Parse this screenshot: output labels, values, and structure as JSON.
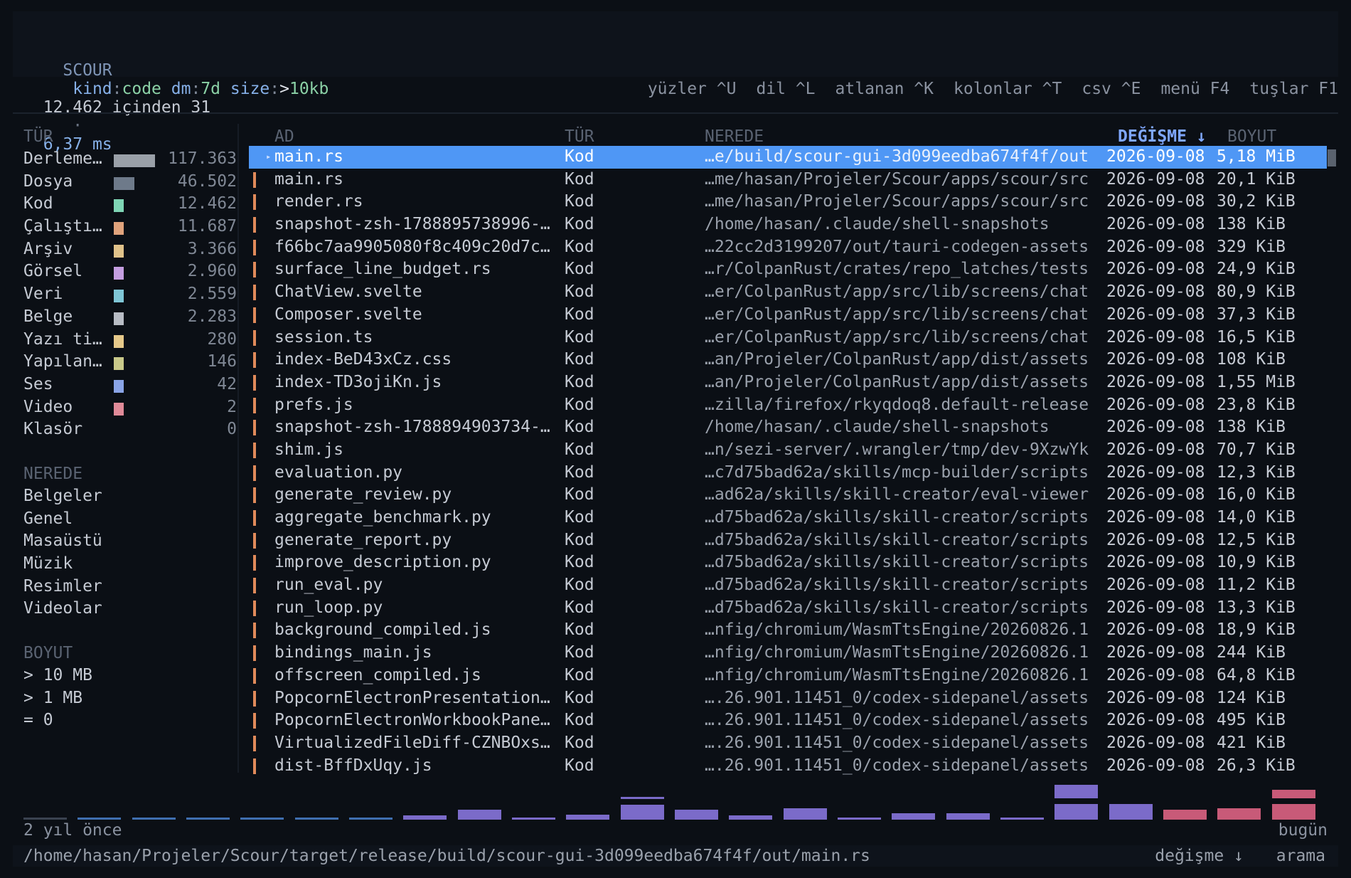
{
  "query": {
    "app": "SCOUR",
    "filters": [
      {
        "key": "kind",
        "value": "code"
      },
      {
        "key": "dm",
        "value": "7d"
      },
      {
        "key": "size",
        "value": ">10kb"
      }
    ]
  },
  "info": {
    "count": "12.462 içinden 31",
    "separator": "·",
    "time": "6,37 ms",
    "shortcuts": [
      "yüzler ^U",
      "dil ^L",
      "atlanan ^K",
      "kolonlar ^T",
      "csv ^E",
      "menü F4",
      "tuşlar F1"
    ]
  },
  "sidebar": {
    "type_header": "TÜR",
    "types": [
      {
        "label": "Derleme…",
        "count": "117.363",
        "color": "#9aa0a8",
        "fill": 1.0
      },
      {
        "label": "Dosya",
        "count": "46.502",
        "color": "#6e7a8a",
        "fill": 0.5
      },
      {
        "label": "Kod",
        "count": "12.462",
        "color": "#7fd6b5",
        "fill": 0.25
      },
      {
        "label": "Çalıştı…",
        "count": "11.687",
        "color": "#e0a37c",
        "fill": 0.25
      },
      {
        "label": "Arşiv",
        "count": "3.366",
        "color": "#e0c28a",
        "fill": 0.25
      },
      {
        "label": "Görsel",
        "count": "2.960",
        "color": "#c49ee0",
        "fill": 0.25
      },
      {
        "label": "Veri",
        "count": "2.559",
        "color": "#7fc6d6",
        "fill": 0.25
      },
      {
        "label": "Belge",
        "count": "2.283",
        "color": "#b8bcc4",
        "fill": 0.25
      },
      {
        "label": "Yazı ti…",
        "count": "280",
        "color": "#e6c98a",
        "fill": 0.25
      },
      {
        "label": "Yapılan…",
        "count": "146",
        "color": "#c9c98a",
        "fill": 0.25
      },
      {
        "label": "Ses",
        "count": "42",
        "color": "#8aa4e6",
        "fill": 0.25
      },
      {
        "label": "Video",
        "count": "2",
        "color": "#e08a98",
        "fill": 0.25
      },
      {
        "label": "Klasör",
        "count": "0",
        "color": "#000000",
        "fill": 0
      }
    ],
    "where_header": "NEREDE",
    "where": [
      "Belgeler",
      "Genel",
      "Masaüstü",
      "Müzik",
      "Resimler",
      "Videolar"
    ],
    "size_header": "BOYUT",
    "sizes": [
      "> 10 MB",
      "> 1 MB",
      "= 0"
    ]
  },
  "table": {
    "headers": {
      "name": "AD",
      "type": "TÜR",
      "where": "NEREDE",
      "modified": "DEĞİŞME ↓",
      "size": "BOYUT"
    },
    "rows": [
      {
        "name": "main.rs",
        "type": "Kod",
        "path": "…e/build/scour-gui-3d099eedba674f4f/out",
        "date": "2026-09-08",
        "size": "5,18 MiB",
        "selected": true
      },
      {
        "name": "main.rs",
        "type": "Kod",
        "path": "…me/hasan/Projeler/Scour/apps/scour/src",
        "date": "2026-09-08",
        "size": "20,1 KiB"
      },
      {
        "name": "render.rs",
        "type": "Kod",
        "path": "…me/hasan/Projeler/Scour/apps/scour/src",
        "date": "2026-09-08",
        "size": "30,2 KiB"
      },
      {
        "name": "snapshot-zsh-1788895738996-…",
        "type": "Kod",
        "path": "/home/hasan/.claude/shell-snapshots",
        "date": "2026-09-08",
        "size": "138 KiB"
      },
      {
        "name": "f66bc7aa9905080f8c409c20d7c…",
        "type": "Kod",
        "path": "…22cc2d3199207/out/tauri-codegen-assets",
        "date": "2026-09-08",
        "size": "329 KiB"
      },
      {
        "name": "surface_line_budget.rs",
        "type": "Kod",
        "path": "…r/ColpanRust/crates/repo_latches/tests",
        "date": "2026-09-08",
        "size": "24,9 KiB"
      },
      {
        "name": "ChatView.svelte",
        "type": "Kod",
        "path": "…er/ColpanRust/app/src/lib/screens/chat",
        "date": "2026-09-08",
        "size": "80,9 KiB"
      },
      {
        "name": "Composer.svelte",
        "type": "Kod",
        "path": "…er/ColpanRust/app/src/lib/screens/chat",
        "date": "2026-09-08",
        "size": "37,3 KiB"
      },
      {
        "name": "session.ts",
        "type": "Kod",
        "path": "…er/ColpanRust/app/src/lib/screens/chat",
        "date": "2026-09-08",
        "size": "16,5 KiB"
      },
      {
        "name": "index-BeD43xCz.css",
        "type": "Kod",
        "path": "…an/Projeler/ColpanRust/app/dist/assets",
        "date": "2026-09-08",
        "size": "108 KiB"
      },
      {
        "name": "index-TD3ojiKn.js",
        "type": "Kod",
        "path": "…an/Projeler/ColpanRust/app/dist/assets",
        "date": "2026-09-08",
        "size": "1,55 MiB"
      },
      {
        "name": "prefs.js",
        "type": "Kod",
        "path": "…zilla/firefox/rkyqdoq8.default-release",
        "date": "2026-09-08",
        "size": "23,8 KiB"
      },
      {
        "name": "snapshot-zsh-1788894903734-…",
        "type": "Kod",
        "path": "/home/hasan/.claude/shell-snapshots",
        "date": "2026-09-08",
        "size": "138 KiB"
      },
      {
        "name": "shim.js",
        "type": "Kod",
        "path": "…n/sezi-server/.wrangler/tmp/dev-9XzwYk",
        "date": "2026-09-08",
        "size": "70,7 KiB"
      },
      {
        "name": "evaluation.py",
        "type": "Kod",
        "path": "…c7d75bad62a/skills/mcp-builder/scripts",
        "date": "2026-09-08",
        "size": "12,3 KiB"
      },
      {
        "name": "generate_review.py",
        "type": "Kod",
        "path": "…ad62a/skills/skill-creator/eval-viewer",
        "date": "2026-09-08",
        "size": "16,0 KiB"
      },
      {
        "name": "aggregate_benchmark.py",
        "type": "Kod",
        "path": "…d75bad62a/skills/skill-creator/scripts",
        "date": "2026-09-08",
        "size": "14,0 KiB"
      },
      {
        "name": "generate_report.py",
        "type": "Kod",
        "path": "…d75bad62a/skills/skill-creator/scripts",
        "date": "2026-09-08",
        "size": "12,5 KiB"
      },
      {
        "name": "improve_description.py",
        "type": "Kod",
        "path": "…d75bad62a/skills/skill-creator/scripts",
        "date": "2026-09-08",
        "size": "10,9 KiB"
      },
      {
        "name": "run_eval.py",
        "type": "Kod",
        "path": "…d75bad62a/skills/skill-creator/scripts",
        "date": "2026-09-08",
        "size": "11,2 KiB"
      },
      {
        "name": "run_loop.py",
        "type": "Kod",
        "path": "…d75bad62a/skills/skill-creator/scripts",
        "date": "2026-09-08",
        "size": "13,3 KiB"
      },
      {
        "name": "background_compiled.js",
        "type": "Kod",
        "path": "…nfig/chromium/WasmTtsEngine/20260826.1",
        "date": "2026-09-08",
        "size": "18,9 KiB"
      },
      {
        "name": "bindings_main.js",
        "type": "Kod",
        "path": "…nfig/chromium/WasmTtsEngine/20260826.1",
        "date": "2026-09-08",
        "size": "244 KiB"
      },
      {
        "name": "offscreen_compiled.js",
        "type": "Kod",
        "path": "…nfig/chromium/WasmTtsEngine/20260826.1",
        "date": "2026-09-08",
        "size": "64,8 KiB"
      },
      {
        "name": "PopcornElectronPresentation…",
        "type": "Kod",
        "path": "….26.901.11451_0/codex-sidepanel/assets",
        "date": "2026-09-08",
        "size": "124 KiB"
      },
      {
        "name": "PopcornElectronWorkbookPane…",
        "type": "Kod",
        "path": "….26.901.11451_0/codex-sidepanel/assets",
        "date": "2026-09-08",
        "size": "495 KiB"
      },
      {
        "name": "VirtualizedFileDiff-CZNBOxs…",
        "type": "Kod",
        "path": "….26.901.11451_0/codex-sidepanel/assets",
        "date": "2026-09-08",
        "size": "421 KiB"
      },
      {
        "name": "dist-BffDxUqy.js",
        "type": "Kod",
        "path": "….26.901.11451_0/codex-sidepanel/assets",
        "date": "2026-09-08",
        "size": "26,3 KiB"
      }
    ]
  },
  "histogram": {
    "left_label": "2 yıl önce",
    "right_label": "bugün",
    "bins": [
      {
        "h": 0.05,
        "h2": 0,
        "color": "#3a4250"
      },
      {
        "h": 0.05,
        "h2": 0,
        "color": "#3f6fb0"
      },
      {
        "h": 0.05,
        "h2": 0,
        "color": "#3f6fb0"
      },
      {
        "h": 0.05,
        "h2": 0,
        "color": "#3f6fb0"
      },
      {
        "h": 0.05,
        "h2": 0,
        "color": "#3f6fb0"
      },
      {
        "h": 0.05,
        "h2": 0,
        "color": "#3f6fb0"
      },
      {
        "h": 0.05,
        "h2": 0,
        "color": "#3f6fb0"
      },
      {
        "h": 0.1,
        "h2": 0,
        "color": "#7b6bc9"
      },
      {
        "h": 0.22,
        "h2": 0,
        "color": "#7b6bc9"
      },
      {
        "h": 0.05,
        "h2": 0,
        "color": "#7b6bc9"
      },
      {
        "h": 0.12,
        "h2": 0,
        "color": "#7b6bc9"
      },
      {
        "h": 0.34,
        "h2": 0.05,
        "color": "#7b6bc9"
      },
      {
        "h": 0.22,
        "h2": 0,
        "color": "#7b6bc9"
      },
      {
        "h": 0.1,
        "h2": 0,
        "color": "#7b6bc9"
      },
      {
        "h": 0.26,
        "h2": 0,
        "color": "#7b6bc9"
      },
      {
        "h": 0.05,
        "h2": 0,
        "color": "#7b6bc9"
      },
      {
        "h": 0.14,
        "h2": 0,
        "color": "#7b6bc9"
      },
      {
        "h": 0.14,
        "h2": 0,
        "color": "#7b6bc9"
      },
      {
        "h": 0.05,
        "h2": 0,
        "color": "#7b6bc9"
      },
      {
        "h": 0.36,
        "h2": 0.3,
        "color": "#7b6bc9"
      },
      {
        "h": 0.36,
        "h2": 0,
        "color": "#7b6bc9"
      },
      {
        "h": 0.22,
        "h2": 0,
        "color": "#c85a78"
      },
      {
        "h": 0.26,
        "h2": 0,
        "color": "#c85a78"
      },
      {
        "h": 0.36,
        "h2": 0.2,
        "color": "#c85a78"
      }
    ]
  },
  "status": {
    "path": "/home/hasan/Projeler/Scour/target/release/build/scour-gui-3d099eedba674f4f/out/main.rs",
    "sort": "değişme ↓",
    "mode": "arama"
  }
}
